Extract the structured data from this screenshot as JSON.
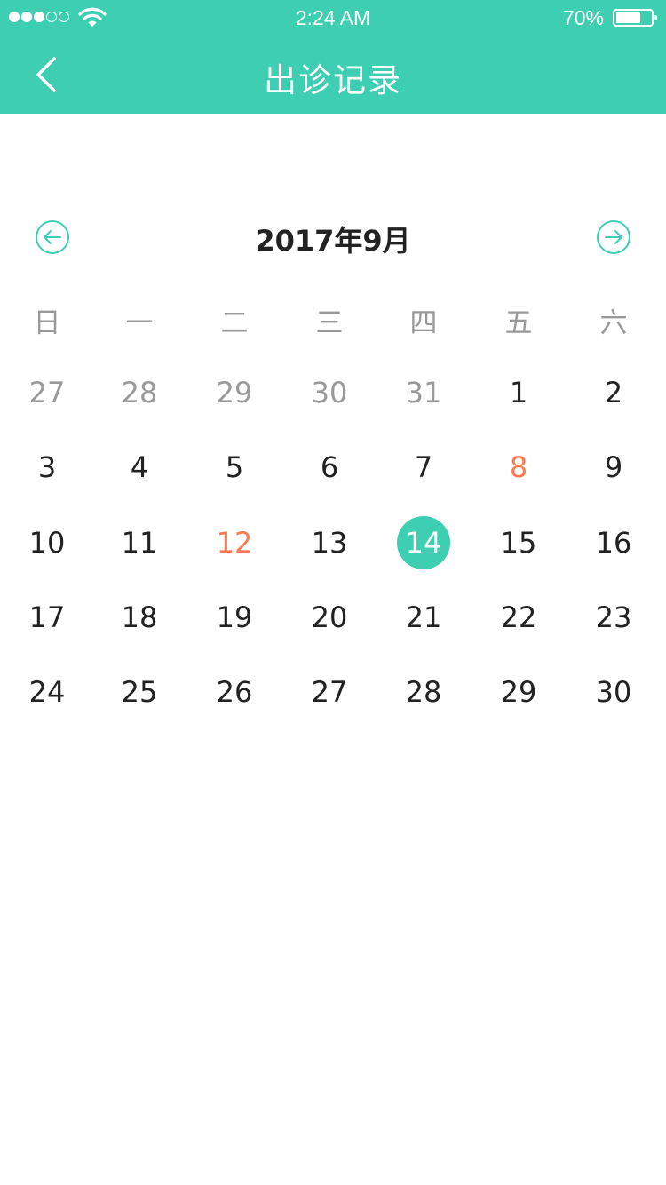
{
  "status_bar": {
    "time": "2:24 AM",
    "battery_percent": "70%",
    "battery_level": 0.7,
    "signal_bars_filled": 3,
    "signal_bars_total": 5
  },
  "nav": {
    "title": "出诊记录",
    "back_icon": "chevron-left-icon"
  },
  "calendar": {
    "month_title": "2017年9月",
    "prev_icon": "arrow-left-circle-icon",
    "next_icon": "arrow-right-circle-icon",
    "weekdays": [
      "日",
      "一",
      "二",
      "三",
      "四",
      "五",
      "六"
    ],
    "weeks": [
      [
        {
          "d": "27",
          "other": true
        },
        {
          "d": "28",
          "other": true
        },
        {
          "d": "29",
          "other": true
        },
        {
          "d": "30",
          "other": true
        },
        {
          "d": "31",
          "other": true
        },
        {
          "d": "1"
        },
        {
          "d": "2"
        }
      ],
      [
        {
          "d": "3"
        },
        {
          "d": "4"
        },
        {
          "d": "5"
        },
        {
          "d": "6"
        },
        {
          "d": "7"
        },
        {
          "d": "8",
          "mark": true
        },
        {
          "d": "9"
        }
      ],
      [
        {
          "d": "10"
        },
        {
          "d": "11"
        },
        {
          "d": "12",
          "mark": true
        },
        {
          "d": "13"
        },
        {
          "d": "14",
          "selected": true
        },
        {
          "d": "15"
        },
        {
          "d": "16"
        }
      ],
      [
        {
          "d": "17"
        },
        {
          "d": "18"
        },
        {
          "d": "19"
        },
        {
          "d": "20"
        },
        {
          "d": "21"
        },
        {
          "d": "22"
        },
        {
          "d": "23"
        }
      ],
      [
        {
          "d": "24"
        },
        {
          "d": "25"
        },
        {
          "d": "26"
        },
        {
          "d": "27"
        },
        {
          "d": "28"
        },
        {
          "d": "29"
        },
        {
          "d": "30"
        }
      ]
    ]
  },
  "colors": {
    "accent": "#3ecfb3",
    "marked_day": "#ff7a4f",
    "other_month_day": "#9a9a9a",
    "weekday_label": "#999999"
  }
}
